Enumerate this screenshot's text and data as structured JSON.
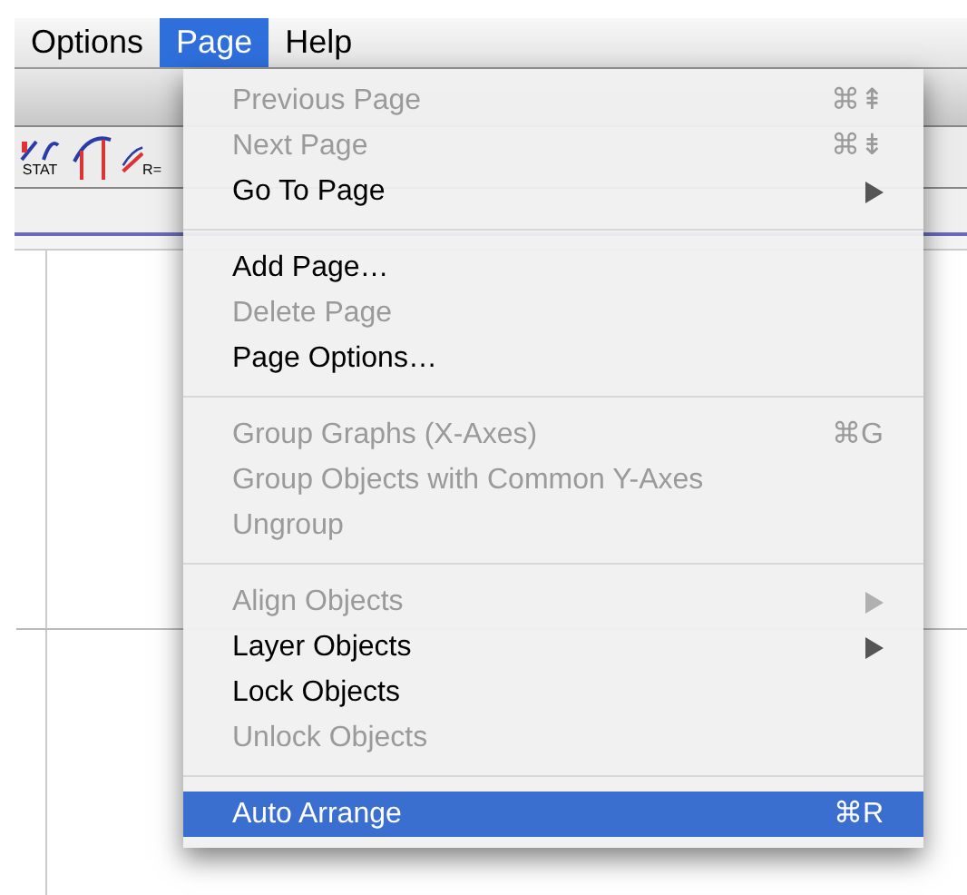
{
  "menu_bar": [
    {
      "label": "Options",
      "selected": false
    },
    {
      "label": "Page",
      "selected": true
    },
    {
      "label": "Help",
      "selected": false
    }
  ],
  "toolbar": [
    {
      "kind": "stat",
      "label": "STAT"
    },
    {
      "kind": "tangent"
    },
    {
      "kind": "regression",
      "label": "R="
    }
  ],
  "menu": {
    "groups": [
      [
        {
          "label": "Previous Page",
          "shortcut": "⌘⇞",
          "disabled": true,
          "submenu": false,
          "selected": false
        },
        {
          "label": "Next Page",
          "shortcut": "⌘⇟",
          "disabled": true,
          "submenu": false,
          "selected": false
        },
        {
          "label": "Go To Page",
          "disabled": false,
          "submenu": true,
          "selected": false
        }
      ],
      [
        {
          "label": "Add Page…",
          "disabled": false,
          "submenu": false,
          "selected": false
        },
        {
          "label": "Delete Page",
          "disabled": true,
          "submenu": false,
          "selected": false
        },
        {
          "label": "Page Options…",
          "disabled": false,
          "submenu": false,
          "selected": false
        }
      ],
      [
        {
          "label": "Group Graphs (X-Axes)",
          "shortcut": "⌘G",
          "disabled": true,
          "submenu": false,
          "selected": false
        },
        {
          "label": "Group Objects with Common Y-Axes",
          "disabled": true,
          "submenu": false,
          "selected": false
        },
        {
          "label": "Ungroup",
          "disabled": true,
          "submenu": false,
          "selected": false
        }
      ],
      [
        {
          "label": "Align Objects",
          "disabled": true,
          "submenu": true,
          "selected": false
        },
        {
          "label": "Layer Objects",
          "disabled": false,
          "submenu": true,
          "selected": false
        },
        {
          "label": "Lock Objects",
          "disabled": false,
          "submenu": false,
          "selected": false
        },
        {
          "label": "Unlock Objects",
          "disabled": true,
          "submenu": false,
          "selected": false
        }
      ],
      [
        {
          "label": "Auto Arrange",
          "shortcut": "⌘R",
          "disabled": false,
          "submenu": false,
          "selected": true
        }
      ]
    ]
  }
}
